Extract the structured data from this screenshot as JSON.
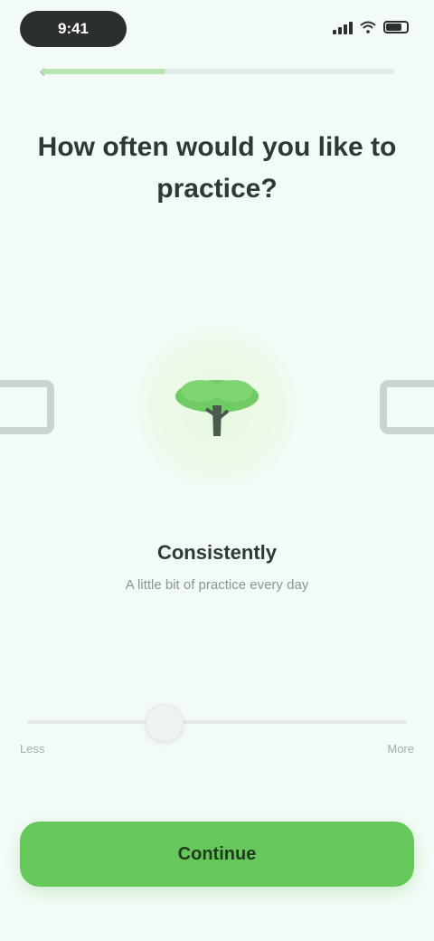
{
  "status_bar": {
    "time": "9:41",
    "icons": [
      "signal-icon",
      "wifi-icon",
      "battery-icon"
    ]
  },
  "header": {
    "back_icon": "chevron-left-icon",
    "progress_fraction": 0.35
  },
  "question": "How often would you like to practice?",
  "carousel": {
    "selected": {
      "icon": "tree-icon",
      "title": "Consistently",
      "description": "A little bit of practice every day"
    },
    "left_icon": "calendar-icon",
    "right_icon": "calendar-icon"
  },
  "slider": {
    "min_label": "Less",
    "max_label": "More",
    "value_fraction": 0.36
  },
  "continue_button": {
    "label": "Continue"
  },
  "colors": {
    "accent": "#66c75b",
    "background": "#f3fbf6"
  }
}
